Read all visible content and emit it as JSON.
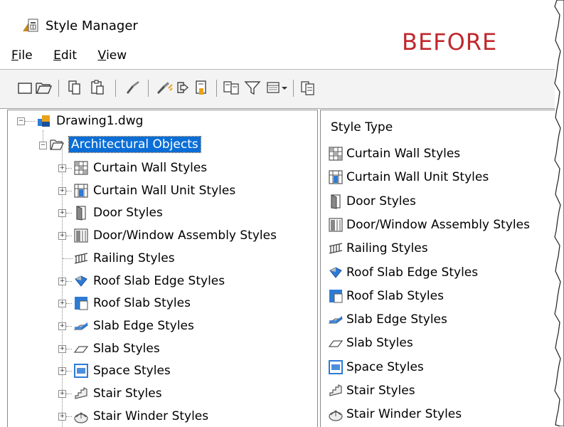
{
  "window": {
    "title": "Style Manager",
    "annotation": "BEFORE"
  },
  "menu": [
    {
      "label": "File",
      "underline": "F"
    },
    {
      "label": "Edit",
      "underline": "E"
    },
    {
      "label": "View",
      "underline": "V"
    }
  ],
  "toolbar": {
    "buttons": [
      "new-icon",
      "open-icon",
      "copy-icon",
      "paste-icon",
      "edit-style-icon",
      "purge-icon",
      "toggle-view-icon",
      "sort-icon",
      "inventory-icon",
      "filter-icon",
      "view-mode-icon",
      "dropdown-arrow-icon",
      "style-manager-icon"
    ]
  },
  "tree": {
    "root": {
      "label": "Drawing1.dwg",
      "icon": "drawing-icon",
      "expanded": true
    },
    "category": {
      "label": "Architectural Objects",
      "icon": "folder-open-icon",
      "expanded": true,
      "selected": true
    },
    "items": [
      {
        "label": "Curtain Wall Styles",
        "icon": "curtain-wall-icon",
        "expandable": true
      },
      {
        "label": "Curtain Wall Unit Styles",
        "icon": "curtain-wall-unit-icon",
        "expandable": true
      },
      {
        "label": "Door Styles",
        "icon": "door-icon",
        "expandable": true
      },
      {
        "label": "Door/Window Assembly Styles",
        "icon": "door-window-assembly-icon",
        "expandable": true
      },
      {
        "label": "Railing Styles",
        "icon": "railing-icon",
        "expandable": false
      },
      {
        "label": "Roof Slab Edge Styles",
        "icon": "roof-slab-edge-icon",
        "expandable": true
      },
      {
        "label": "Roof Slab Styles",
        "icon": "roof-slab-icon",
        "expandable": true
      },
      {
        "label": "Slab Edge Styles",
        "icon": "slab-edge-icon",
        "expandable": true
      },
      {
        "label": "Slab Styles",
        "icon": "slab-icon",
        "expandable": true
      },
      {
        "label": "Space Styles",
        "icon": "space-icon",
        "expandable": true
      },
      {
        "label": "Stair Styles",
        "icon": "stair-icon",
        "expandable": true
      },
      {
        "label": "Stair Winder Styles",
        "icon": "stair-winder-icon",
        "expandable": true
      }
    ]
  },
  "list": {
    "header": "Style Type",
    "items": [
      {
        "label": "Curtain Wall Styles",
        "icon": "curtain-wall-icon"
      },
      {
        "label": "Curtain Wall Unit Styles",
        "icon": "curtain-wall-unit-icon"
      },
      {
        "label": "Door Styles",
        "icon": "door-icon"
      },
      {
        "label": "Door/Window Assembly Styles",
        "icon": "door-window-assembly-icon"
      },
      {
        "label": "Railing Styles",
        "icon": "railing-icon"
      },
      {
        "label": "Roof Slab Edge Styles",
        "icon": "roof-slab-edge-icon"
      },
      {
        "label": "Roof Slab Styles",
        "icon": "roof-slab-icon"
      },
      {
        "label": "Slab Edge Styles",
        "icon": "slab-edge-icon"
      },
      {
        "label": "Slab Styles",
        "icon": "slab-icon"
      },
      {
        "label": "Space Styles",
        "icon": "space-icon"
      },
      {
        "label": "Stair Styles",
        "icon": "stair-icon"
      },
      {
        "label": "Stair Winder Styles",
        "icon": "stair-winder-icon"
      }
    ]
  },
  "colors": {
    "annotation": "#c0282d",
    "selection": "#0a6ed6",
    "toolbar_bg": "#f3f3f3",
    "icon_blue": "#2e7bd6",
    "icon_orange": "#e8a21a"
  }
}
